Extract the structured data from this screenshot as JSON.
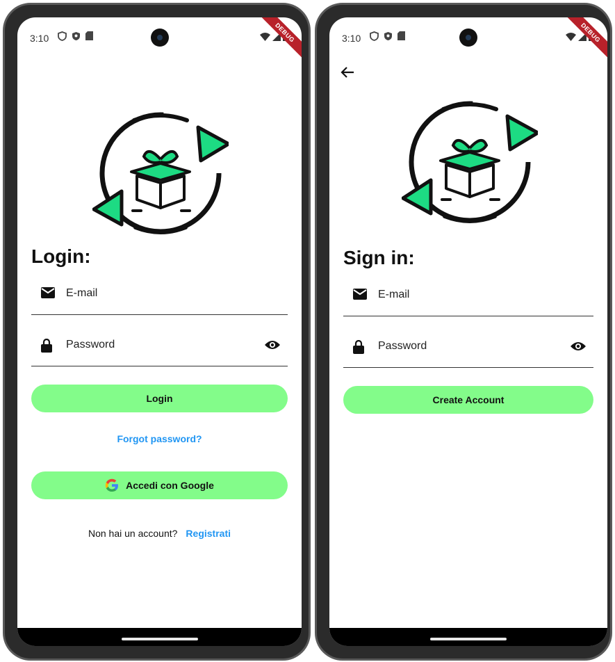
{
  "status": {
    "time": "3:10",
    "debug": "DEBUG"
  },
  "login": {
    "heading": "Login:",
    "email_placeholder": "E-mail",
    "password_placeholder": "Password",
    "login_button": "Login",
    "forgot_link": "Forgot password?",
    "google_button": "Accedi con Google",
    "no_account_text": "Non hai un account?",
    "register_link": "Registrati"
  },
  "signin": {
    "heading": "Sign in:",
    "email_placeholder": "E-mail",
    "password_placeholder": "Password",
    "create_button": "Create Account"
  },
  "colors": {
    "accent": "#83fc8a",
    "link": "#2196f3",
    "logo_green": "#1ddb83"
  }
}
